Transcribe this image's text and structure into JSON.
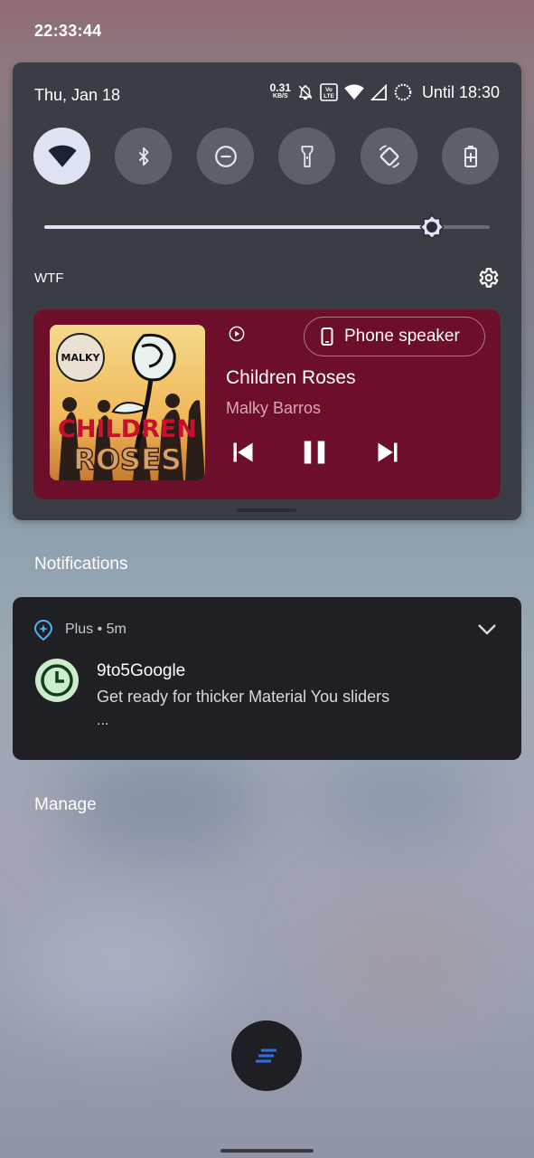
{
  "status_bar": {
    "time": "22:33:44"
  },
  "quick_settings": {
    "date": "Thu, Jan 18",
    "net_speed_value": "0.31",
    "net_speed_unit": "KB/S",
    "volte_label": "Vo LTE",
    "until": "Until 18:30",
    "tiles": [
      {
        "icon": "wifi-icon",
        "active": true
      },
      {
        "icon": "bluetooth-icon",
        "active": false
      },
      {
        "icon": "do-not-disturb-icon",
        "active": false
      },
      {
        "icon": "flashlight-icon",
        "active": false
      },
      {
        "icon": "auto-rotate-icon",
        "active": false
      },
      {
        "icon": "battery-saver-icon",
        "active": false
      }
    ],
    "brightness_fraction": 0.87,
    "network_name": "WTF"
  },
  "media": {
    "album_art_text_top": "CHILDREN",
    "album_art_text_bottom": "ROSES",
    "album_art_logo": "MALKY",
    "output_device": "Phone speaker",
    "title": "Children Roses",
    "artist": "Malky Barros",
    "state": "playing",
    "card_color": "#6d0f2b"
  },
  "notifications": {
    "header": "Notifications",
    "items": [
      {
        "app_line": "Plus • 5m",
        "title": "9to5Google",
        "body": "Get ready for thicker Material You sliders",
        "more": "..."
      }
    ],
    "manage_label": "Manage"
  },
  "colors": {
    "accent": "#dde3f3",
    "fab_icon": "#2f6fe0"
  }
}
